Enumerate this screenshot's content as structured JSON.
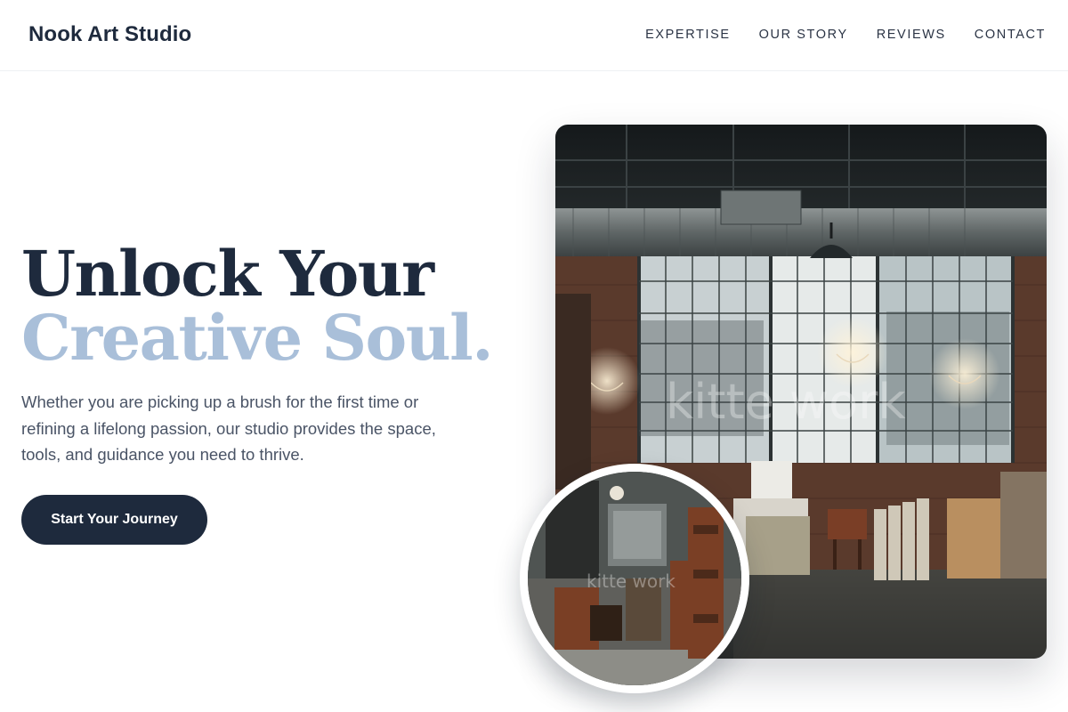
{
  "header": {
    "brand": "Nook Art Studio",
    "nav": [
      "EXPERTISE",
      "OUR STORY",
      "REVIEWS",
      "CONTACT"
    ]
  },
  "hero": {
    "title_line1": "Unlock Your",
    "title_line2": "Creative Soul.",
    "description": "Whether you are picking up a brush for the first time or refining a lifelong passion, our studio provides the space, tools, and guidance you need to thrive.",
    "cta_label": "Start Your Journey"
  },
  "images": {
    "main_watermark": "kitte work",
    "circle_watermark": "kitte work"
  },
  "colors": {
    "primary": "#1e2a3d",
    "accent": "#a9bfd9",
    "body_text": "#4a5466"
  }
}
